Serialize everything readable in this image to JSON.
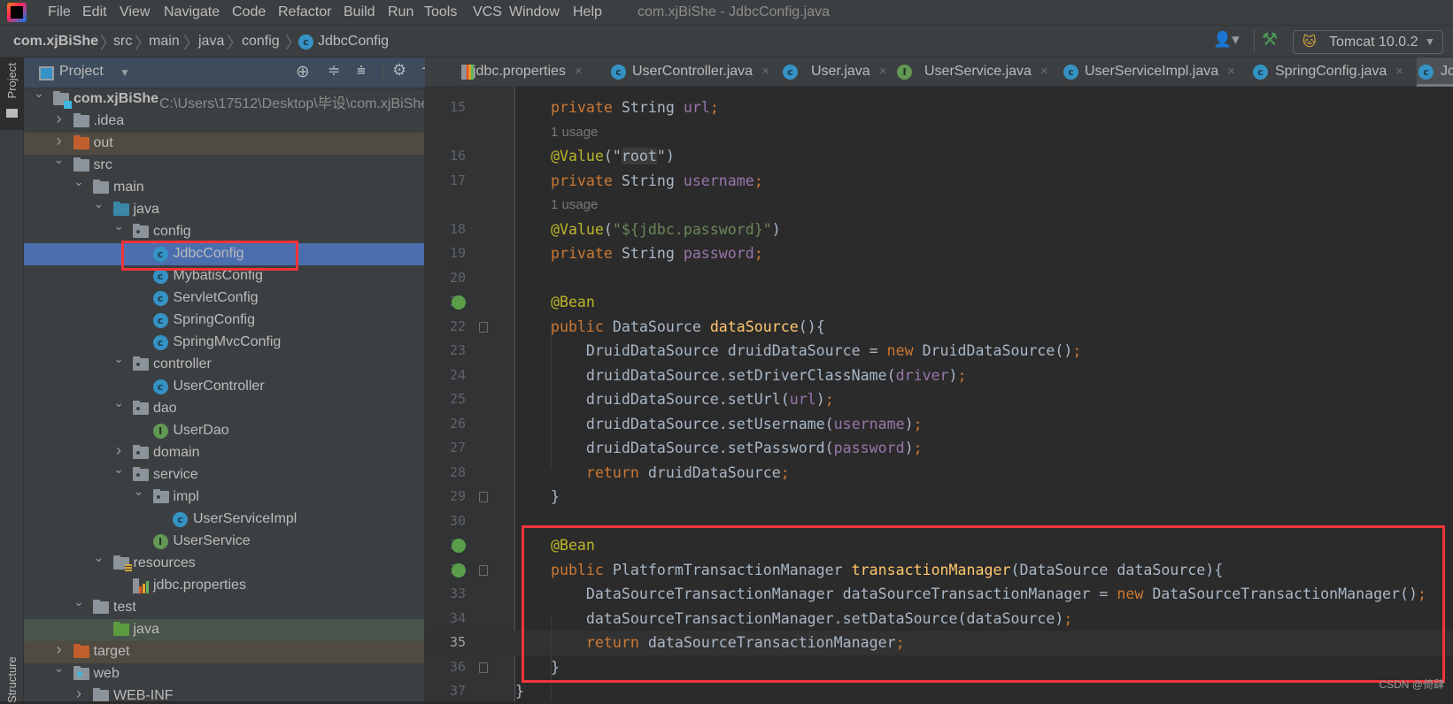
{
  "menubar": {
    "items": [
      "File",
      "Edit",
      "View",
      "Navigate",
      "Code",
      "Refactor",
      "Build",
      "Run",
      "Tools",
      "VCS",
      "Window",
      "Help"
    ],
    "title": "com.xjBiShe - JdbcConfig.java"
  },
  "breadcrumb": [
    "com.xjBiShe",
    "src",
    "main",
    "java",
    "config",
    "JdbcConfig"
  ],
  "toolbar": {
    "run_config": "Tomcat 10.0.2"
  },
  "stripe": {
    "project": "Project",
    "structure": "Structure"
  },
  "project_panel": {
    "title": "Project",
    "tree": [
      {
        "label": "com.xjBiShe",
        "path": "C:\\Users\\17512\\Desktop\\毕设\\com.xjBiShe",
        "level": 0,
        "chevron": "open",
        "icon": "module-folder"
      },
      {
        "label": ".idea",
        "level": 1,
        "chevron": "closed",
        "icon": "folder"
      },
      {
        "label": "out",
        "level": 1,
        "chevron": "closed",
        "icon": "excluded-folder"
      },
      {
        "label": "src",
        "level": 1,
        "chevron": "open",
        "icon": "folder"
      },
      {
        "label": "main",
        "level": 2,
        "chevron": "open",
        "icon": "folder"
      },
      {
        "label": "java",
        "level": 3,
        "chevron": "open",
        "icon": "source-folder"
      },
      {
        "label": "config",
        "level": 4,
        "chevron": "open",
        "icon": "package"
      },
      {
        "label": "JdbcConfig",
        "level": 5,
        "icon": "class",
        "selected": true
      },
      {
        "label": "MybatisConfig",
        "level": 5,
        "icon": "class"
      },
      {
        "label": "ServletConfig",
        "level": 5,
        "icon": "class"
      },
      {
        "label": "SpringConfig",
        "level": 5,
        "icon": "class"
      },
      {
        "label": "SpringMvcConfig",
        "level": 5,
        "icon": "class"
      },
      {
        "label": "controller",
        "level": 4,
        "chevron": "open",
        "icon": "package"
      },
      {
        "label": "UserController",
        "level": 5,
        "icon": "class"
      },
      {
        "label": "dao",
        "level": 4,
        "chevron": "open",
        "icon": "package"
      },
      {
        "label": "UserDao",
        "level": 5,
        "icon": "interface"
      },
      {
        "label": "domain",
        "level": 4,
        "chevron": "closed",
        "icon": "package"
      },
      {
        "label": "service",
        "level": 4,
        "chevron": "open",
        "icon": "package"
      },
      {
        "label": "impl",
        "level": 5,
        "chevron": "open",
        "icon": "package"
      },
      {
        "label": "UserServiceImpl",
        "level": 6,
        "icon": "class"
      },
      {
        "label": "UserService",
        "level": 5,
        "icon": "interface"
      },
      {
        "label": "resources",
        "level": 3,
        "chevron": "open",
        "icon": "resources-folder"
      },
      {
        "label": "jdbc.properties",
        "level": 4,
        "icon": "properties-file"
      },
      {
        "label": "test",
        "level": 2,
        "chevron": "open",
        "icon": "folder"
      },
      {
        "label": "java",
        "level": 3,
        "icon": "test-folder"
      },
      {
        "label": "target",
        "level": 1,
        "chevron": "closed",
        "icon": "excluded-folder"
      },
      {
        "label": "web",
        "level": 1,
        "chevron": "open",
        "icon": "web-folder"
      },
      {
        "label": "WEB-INF",
        "level": 2,
        "chevron": "closed",
        "icon": "folder"
      }
    ]
  },
  "tabs": [
    {
      "label": "jdbc.properties",
      "icon": "properties-file"
    },
    {
      "label": "UserController.java",
      "icon": "class"
    },
    {
      "label": "User.java",
      "icon": "class"
    },
    {
      "label": "UserService.java",
      "icon": "interface"
    },
    {
      "label": "UserServiceImpl.java",
      "icon": "class"
    },
    {
      "label": "SpringConfig.java",
      "icon": "class"
    },
    {
      "label": "Jc",
      "icon": "class",
      "active": true
    }
  ],
  "editor": {
    "current_line": 35,
    "lines": [
      {
        "n": "15",
        "tokens": [
          {
            "c": "k",
            "t": "    private "
          },
          {
            "c": "t",
            "t": "String "
          },
          {
            "c": "f",
            "t": "url"
          },
          {
            "c": "k",
            "t": ";"
          }
        ]
      },
      {
        "hint": "1 usage"
      },
      {
        "n": "16",
        "tokens": [
          {
            "c": "a",
            "t": "    @Value"
          },
          {
            "c": "t",
            "t": "(\""
          },
          {
            "c": "h",
            "t": "root"
          },
          {
            "c": "t",
            "t": "\")"
          }
        ]
      },
      {
        "n": "17",
        "tokens": [
          {
            "c": "k",
            "t": "    private "
          },
          {
            "c": "t",
            "t": "String "
          },
          {
            "c": "f",
            "t": "username"
          },
          {
            "c": "k",
            "t": ";"
          }
        ]
      },
      {
        "hint": "1 usage"
      },
      {
        "n": "18",
        "tokens": [
          {
            "c": "a",
            "t": "    @Value"
          },
          {
            "c": "t",
            "t": "("
          },
          {
            "c": "s",
            "t": "\"${jdbc.password}\""
          },
          {
            "c": "t",
            "t": ")"
          }
        ]
      },
      {
        "n": "19",
        "tokens": [
          {
            "c": "k",
            "t": "    private "
          },
          {
            "c": "t",
            "t": "String "
          },
          {
            "c": "f",
            "t": "password"
          },
          {
            "c": "k",
            "t": ";"
          }
        ]
      },
      {
        "n": "20",
        "tokens": []
      },
      {
        "n": "21",
        "gutter": "bean",
        "tokens": [
          {
            "c": "a",
            "t": "    @Bean"
          }
        ]
      },
      {
        "n": "22",
        "fold": true,
        "tokens": [
          {
            "c": "k",
            "t": "    public "
          },
          {
            "c": "t",
            "t": "DataSource "
          },
          {
            "c": "m",
            "t": "dataSource"
          },
          {
            "c": "t",
            "t": "(){"
          }
        ]
      },
      {
        "n": "23",
        "tokens": [
          {
            "c": "t",
            "t": "        DruidDataSource druidDataSource = "
          },
          {
            "c": "k",
            "t": "new "
          },
          {
            "c": "t",
            "t": "DruidDataSource()"
          },
          {
            "c": "k",
            "t": ";"
          }
        ]
      },
      {
        "n": "24",
        "tokens": [
          {
            "c": "t",
            "t": "        druidDataSource.setDriverClassName("
          },
          {
            "c": "f",
            "t": "driver"
          },
          {
            "c": "t",
            "t": ")"
          },
          {
            "c": "k",
            "t": ";"
          }
        ]
      },
      {
        "n": "25",
        "tokens": [
          {
            "c": "t",
            "t": "        druidDataSource.setUrl("
          },
          {
            "c": "f",
            "t": "url"
          },
          {
            "c": "t",
            "t": ")"
          },
          {
            "c": "k",
            "t": ";"
          }
        ]
      },
      {
        "n": "26",
        "tokens": [
          {
            "c": "t",
            "t": "        druidDataSource.setUsername("
          },
          {
            "c": "f",
            "t": "username"
          },
          {
            "c": "t",
            "t": ")"
          },
          {
            "c": "k",
            "t": ";"
          }
        ]
      },
      {
        "n": "27",
        "tokens": [
          {
            "c": "t",
            "t": "        druidDataSource.setPassword("
          },
          {
            "c": "f",
            "t": "password"
          },
          {
            "c": "t",
            "t": ")"
          },
          {
            "c": "k",
            "t": ";"
          }
        ]
      },
      {
        "n": "28",
        "tokens": [
          {
            "c": "k",
            "t": "        return "
          },
          {
            "c": "t",
            "t": "druidDataSource"
          },
          {
            "c": "k",
            "t": ";"
          }
        ]
      },
      {
        "n": "29",
        "fold": true,
        "tokens": [
          {
            "c": "t",
            "t": "    }"
          }
        ]
      },
      {
        "n": "30",
        "tokens": []
      },
      {
        "n": "31",
        "gutter": "bean",
        "tokens": [
          {
            "c": "a",
            "t": "    @Bean"
          }
        ]
      },
      {
        "n": "32",
        "gutter": "bean",
        "fold": true,
        "tokens": [
          {
            "c": "k",
            "t": "    public "
          },
          {
            "c": "t",
            "t": "PlatformTransactionManager "
          },
          {
            "c": "m",
            "t": "transactionManager"
          },
          {
            "c": "t",
            "t": "(DataSource dataSource){"
          }
        ]
      },
      {
        "n": "33",
        "tokens": [
          {
            "c": "t",
            "t": "        DataSourceTransactionManager dataSourceTransactionManager = "
          },
          {
            "c": "k",
            "t": "new "
          },
          {
            "c": "t",
            "t": "DataSourceTransactionManager()"
          },
          {
            "c": "k",
            "t": ";"
          }
        ]
      },
      {
        "n": "34",
        "tokens": [
          {
            "c": "t",
            "t": "        dataSourceTransactionManager.setDataSource(dataSource)"
          },
          {
            "c": "k",
            "t": ";"
          }
        ]
      },
      {
        "n": "35",
        "tokens": [
          {
            "c": "k",
            "t": "        return "
          },
          {
            "c": "t",
            "t": "dataSourceTransactionManager"
          },
          {
            "c": "k",
            "t": ";"
          }
        ]
      },
      {
        "n": "36",
        "fold": true,
        "tokens": [
          {
            "c": "t",
            "t": "    }"
          }
        ]
      },
      {
        "n": "37",
        "tokens": [
          {
            "c": "t",
            "t": "}"
          }
        ]
      }
    ]
  },
  "colors": {
    "annotation_box": "#f2343b",
    "selection": "#4b6eaf",
    "keyword": "#cc7832",
    "annotation": "#bbb529",
    "string": "#6a8759",
    "field": "#9876aa",
    "method": "#ffc66d"
  },
  "watermark": "CSDN @倚肆"
}
